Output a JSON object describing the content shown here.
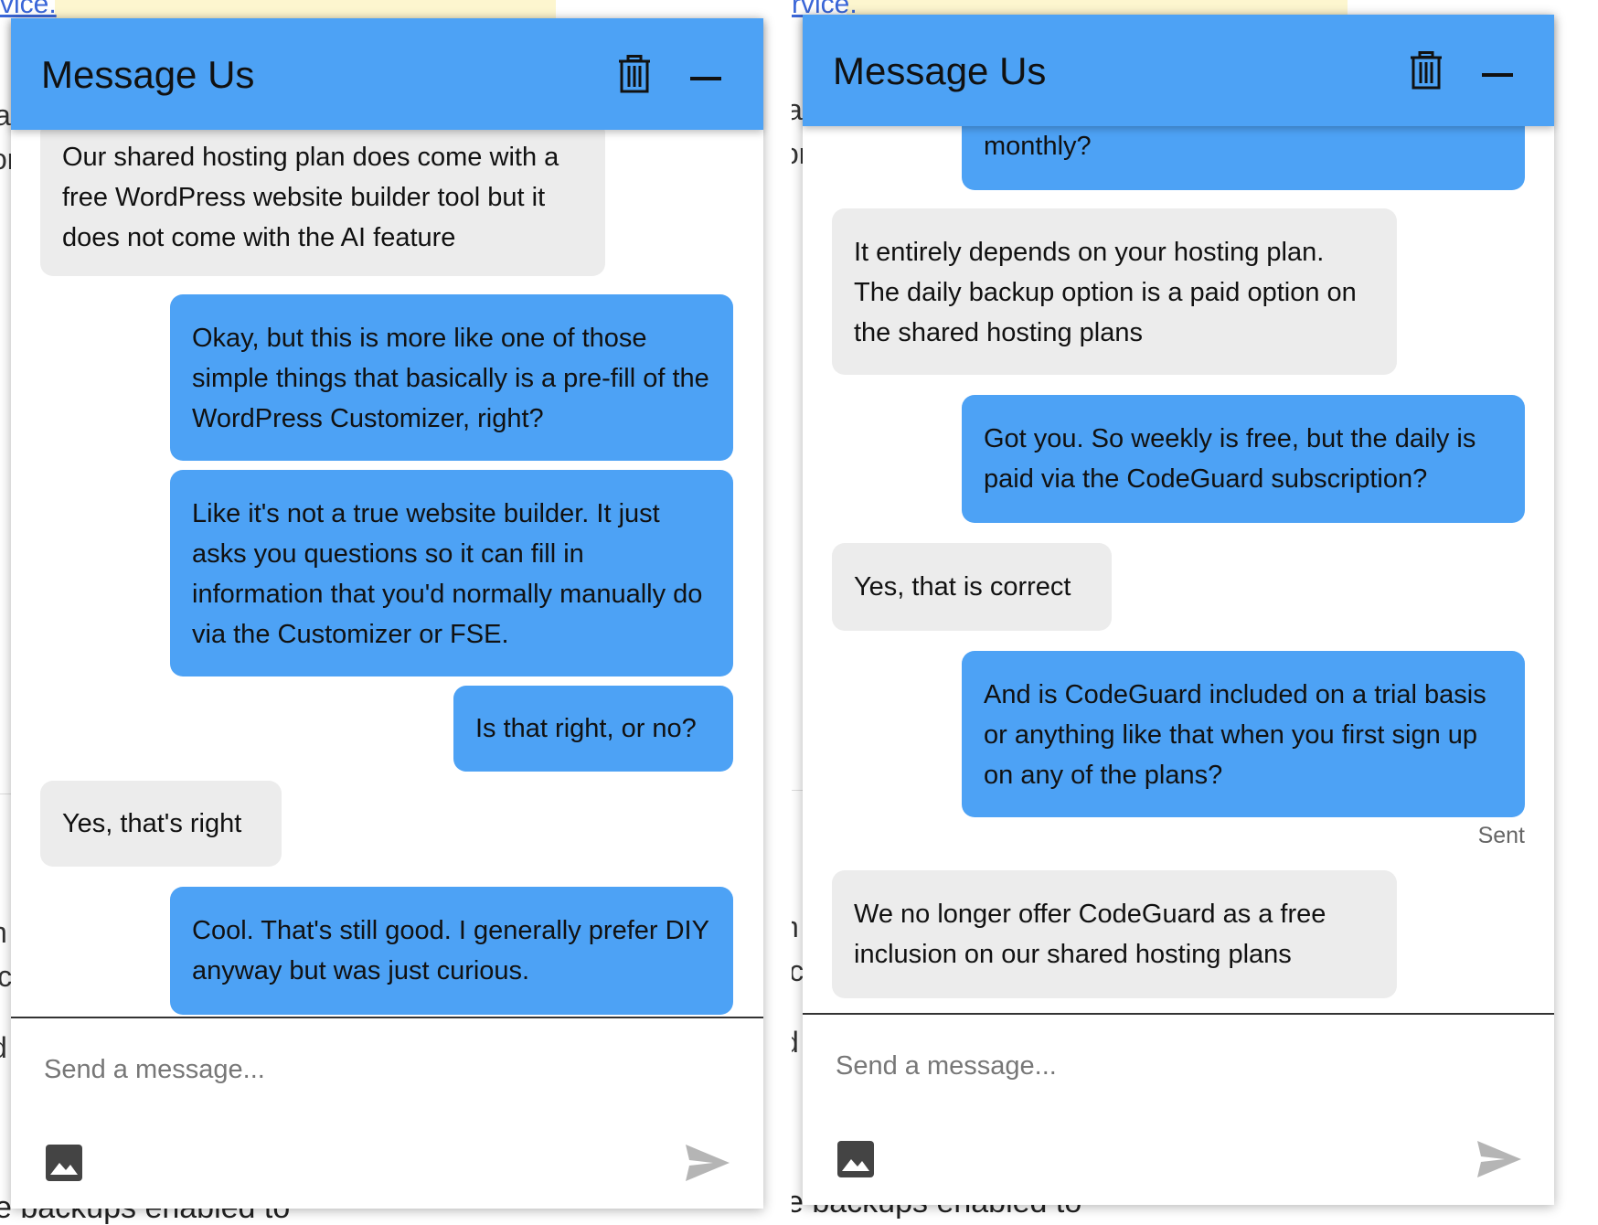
{
  "background_page": {
    "link_fragment_left": "vice.",
    "link_fragment_right": "rvice.",
    "bottom_text_left": "e backups enabled to",
    "bottom_text_right": "e backups enabled to",
    "side_fragments_left": [
      "a",
      "or",
      "n",
      "lc",
      "d"
    ],
    "side_fragments_right": [
      "a",
      "or",
      "n",
      "lc",
      "d"
    ]
  },
  "chat_left": {
    "title": "Message Us",
    "messages": [
      {
        "sender": "agent",
        "text": "Our shared hosting plan does come with a free WordPress website builder tool but it does not come with the AI feature"
      },
      {
        "sender": "user",
        "text": "Okay, but this is more like one of those simple things that basically is a pre-fill of the WordPress Customizer, right?"
      },
      {
        "sender": "user",
        "text": "Like it's not a true website builder. It just asks you questions so it can fill in information that you'd normally manually do via the Customizer or FSE."
      },
      {
        "sender": "user",
        "text": "Is that right, or no?"
      },
      {
        "sender": "agent",
        "text": "Yes, that's right"
      },
      {
        "sender": "user",
        "text": "Cool. That's still good. I generally prefer DIY anyway but was just curious."
      }
    ],
    "input_placeholder": "Send a message...",
    "icons": [
      "trash-icon",
      "minimize-icon",
      "image-icon",
      "send-icon"
    ]
  },
  "chat_right": {
    "title": "Message Us",
    "messages": [
      {
        "sender": "user",
        "text": "monthly?"
      },
      {
        "sender": "agent",
        "text": "It entirely depends on your hosting plan. The daily backup option is a paid option on the shared hosting plans"
      },
      {
        "sender": "user",
        "text": "Got you. So weekly is free, but the daily is paid via the CodeGuard subscription?"
      },
      {
        "sender": "agent",
        "text": "Yes, that is correct"
      },
      {
        "sender": "user",
        "text": "And is CodeGuard included on a trial basis or anything like that when you first sign up on any of the plans?"
      },
      {
        "sender": "agent",
        "text": "We no longer offer CodeGuard as a free inclusion on our shared hosting plans"
      }
    ],
    "sent_status": "Sent",
    "input_placeholder": "Send a message...",
    "icons": [
      "trash-icon",
      "minimize-icon",
      "image-icon",
      "send-icon"
    ]
  },
  "colors": {
    "header_blue": "#4da2f5",
    "user_bubble": "#4da2f5",
    "agent_bubble": "#ececec",
    "link_blue": "#3a66d8"
  }
}
